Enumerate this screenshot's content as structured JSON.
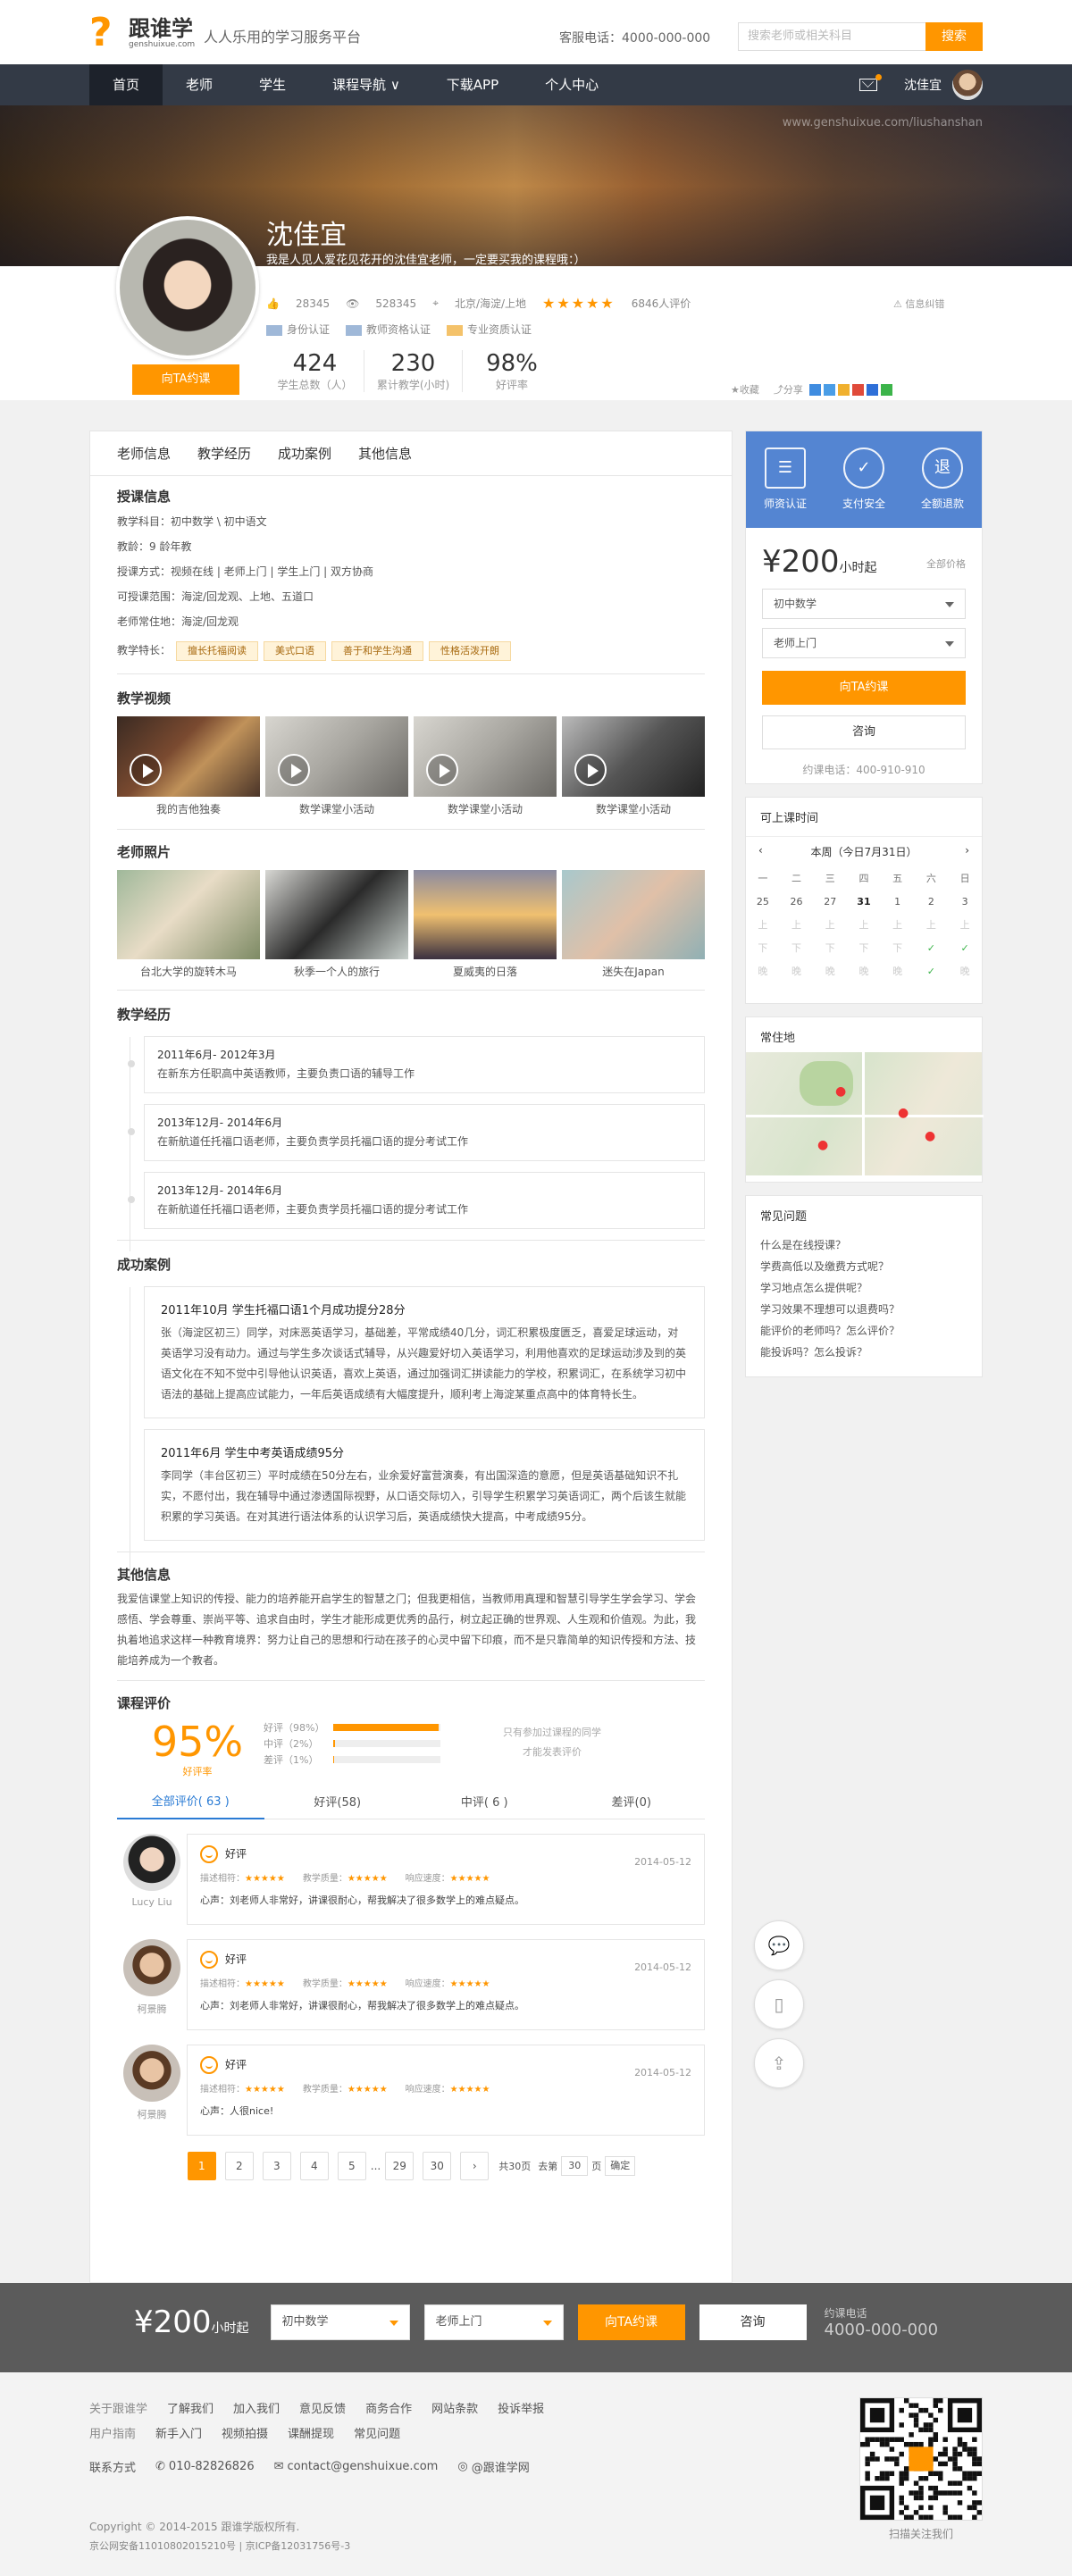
{
  "header": {
    "brand_cn": "跟谁学",
    "brand_en": "genshuixue.com",
    "slogan": "人人乐用的学习服务平台",
    "hotline": "客服电话：4000-000-000",
    "search_placeholder": "搜索老师或相关科目",
    "search_btn": "搜索"
  },
  "nav": {
    "items": [
      "首页",
      "老师",
      "学生",
      "课程导航 ∨",
      "下载APP",
      "个人中心"
    ],
    "user": "沈佳宜"
  },
  "banner": {
    "site": "www.genshuixue.com/liushanshan"
  },
  "teacher": {
    "name": "沈佳宜",
    "motto": "我是人见人爱花见花开的沈佳宜老师，一定要买我的课程哦：）",
    "likes": "28345",
    "views": "528345",
    "location": "北京/海淀/上地",
    "stars": "★★★★★",
    "reviews": "6846人评价",
    "certs": [
      "身份认证",
      "教师资格认证",
      "专业资质认证"
    ],
    "hire": "向TA约课",
    "report": "信息纠错",
    "fav": "收藏",
    "share": "分享",
    "nums": [
      {
        "v": "424",
        "l": "学生总数（人）"
      },
      {
        "v": "230",
        "l": "累计教学(小时)"
      },
      {
        "v": "98%",
        "l": "好评率"
      }
    ]
  },
  "tabs": [
    "老师信息",
    "教学经历",
    "成功案例",
    "其他信息"
  ],
  "info": {
    "title": "授课信息",
    "lines": [
      "教学科目：初中数学 \\ 初中语文",
      "教龄：9 龄年教",
      "授课方式：视频在线 | 老师上门 | 学生上门 | 双方协商",
      "可授课范围：海淀/回龙观、上地、五道口",
      "老师常住地：海淀/回龙观"
    ],
    "tag_label": "教学特长：",
    "tags": [
      "擅长托福阅读",
      "美式口语",
      "善于和学生沟通",
      "性格活泼开朗"
    ]
  },
  "videos": {
    "title": "教学视频",
    "items": [
      "我的吉他独奏",
      "数学课堂小活动",
      "数学课堂小活动",
      "数学课堂小活动"
    ]
  },
  "photos": {
    "title": "老师照片",
    "items": [
      "台北大学的旋转木马",
      "秋季一个人的旅行",
      "夏威夷的日落",
      "迷失在Japan"
    ]
  },
  "experience": {
    "title": "教学经历",
    "items": [
      {
        "d": "2011年6月- 2012年3月",
        "t": "在新东方任职高中英语教师，主要负责口语的辅导工作"
      },
      {
        "d": "2013年12月- 2014年6月",
        "t": "在新航道任托福口语老师，主要负责学员托福口语的提分考试工作"
      },
      {
        "d": "2013年12月- 2014年6月",
        "t": "在新航道任托福口语老师，主要负责学员托福口语的提分考试工作"
      }
    ]
  },
  "cases": {
    "title": "成功案例",
    "items": [
      {
        "d": "2011年10月  学生托福口语1个月成功提分28分",
        "t": "张（海淀区初三）同学，对床恶英语学习，基础差，平常成绩40几分，词汇积累极度匮乏，喜爱足球运动，对英语学习没有动力。通过与学生多次谈话式辅导，从兴趣爱好切入英语学习，利用他喜欢的足球运动涉及到的英语文化在不知不觉中引导他认识英语，喜欢上英语，通过加强词汇拼读能力的学校，积累词汇，在系统学习初中语法的基础上提高应试能力，一年后英语成绩有大幅度提升，顺利考上海淀某重点高中的体育特长生。"
      },
      {
        "d": "2011年6月  学生中考英语成绩95分",
        "t": "李同学（丰台区初三）平时成绩在50分左右，业余爱好富营演奏，有出国深造的意愿，但是英语基础知识不扎实，不愿付出，我在辅导中通过渗透国际视野，从口语交际切入，引导学生积累学习英语词汇，两个后该生就能积累的学习英语。在对其进行语法体系的认识学习后，英语成绩快大提高，中考成绩95分。"
      }
    ]
  },
  "other": {
    "title": "其他信息",
    "text": "我爱信课堂上知识的传授、能力的培养能开启学生的智慧之门；但我更相信，当教师用真理和智慧引导学生学会学习、学会感悟、学会尊重、崇尚平等、追求自由时，学生才能形成更优秀的品行，树立起正确的世界观、人生观和价值观。为此，我执着地追求这样一种教育境界：努力让自己的思想和行动在孩子的心灵中留下印痕，而不是只靠简单的知识传授和方法、技能培养成为一个教者。"
  },
  "eval": {
    "title": "课程评价",
    "pct": "95%",
    "pct_label": "好评率",
    "rows": [
      {
        "l": "好评（98%）",
        "v": 0.98
      },
      {
        "l": "中评（2%）",
        "v": 0.02
      },
      {
        "l": "差评（1%）",
        "v": 0.01
      }
    ],
    "note1": "只有参加过课程的同学",
    "note2": "才能发表评价",
    "tabs": [
      "全部评价( 63 )",
      "好评(58)",
      "中评( 6 )",
      "差评(0)"
    ],
    "metric1": "描述相符：",
    "metric2": "教学质量：",
    "metric3": "响应速度：",
    "mstars": "★★★★★",
    "reviews": [
      {
        "who": "Lucy Liu",
        "g": "好评",
        "date": "2014-05-12",
        "c": "心声：刘老师人非常好，讲课很耐心，帮我解决了很多数学上的难点疑点。"
      },
      {
        "who": "柯景腾",
        "g": "好评",
        "date": "2014-05-12",
        "c": "心声：刘老师人非常好，讲课很耐心，帮我解决了很多数学上的难点疑点。"
      },
      {
        "who": "柯景腾",
        "g": "好评",
        "date": "2014-05-12",
        "c": "心声：人很nice!"
      }
    ]
  },
  "pager": {
    "pages": [
      "1",
      "2",
      "3",
      "4",
      "5",
      "...",
      "29",
      "30"
    ],
    "total": "共30页",
    "goto": "去第",
    "goto_val": "30",
    "page": "页",
    "ok": "确定"
  },
  "sidebar": {
    "feat": [
      "师资认证",
      "支付安全",
      "全额退款"
    ],
    "price": "¥200",
    "unit": "小时起",
    "all_price": "全部价格",
    "sel1": "初中数学",
    "sel2": "老师上门",
    "hire": "向TA约课",
    "consult": "咨询",
    "phone": "约课电话：400-910-910",
    "cal_title": "可上课时间",
    "cal_week": "本周（今日7月31日）",
    "weekdays": [
      "一",
      "二",
      "三",
      "四",
      "五",
      "六",
      "日"
    ],
    "dates": [
      "25",
      "26",
      "27",
      "31",
      "1",
      "2",
      "3"
    ],
    "rows": [
      [
        "上",
        "上",
        "上",
        "上",
        "上",
        "上",
        "上"
      ],
      [
        "下",
        "下",
        "下",
        "下",
        "下",
        "✓",
        "✓"
      ],
      [
        "晚",
        "晚",
        "晚",
        "晚",
        "晚",
        "✓",
        "晚"
      ]
    ],
    "map_title": "常住地",
    "faq_title": "常见问题",
    "faq": [
      "什么是在线授课？",
      "学费高低以及缴费方式呢？",
      "学习地点怎么提供呢？",
      "学习效果不理想可以退费吗？",
      "能评价的老师吗？怎么评价？",
      "能投诉吗？怎么投诉？"
    ]
  },
  "bottombar": {
    "price": "¥200",
    "unit": "小时起",
    "sel1": "初中数学",
    "sel2": "老师上门",
    "hire": "向TA约课",
    "consult": "咨询",
    "phone_label": "约课电话",
    "phone": "4000-000-000"
  },
  "footer": {
    "row1": [
      "关于跟谁学",
      "了解我们",
      "加入我们",
      "意见反馈",
      "商务合作",
      "网站条款",
      "投诉举报"
    ],
    "row2": [
      "用户指南",
      "新手入门",
      "视频拍摄",
      "课酬提现",
      "常见问题"
    ],
    "contact": "联系方式",
    "tel": "010-82826826",
    "mail": "contact@genshuixue.com",
    "weibo": "@跟谁学网",
    "copyright": "Copyright © 2014-2015 跟谁学版权所有.",
    "icp": "京公网安备11010802015210号 | 京ICP备12031756号-3",
    "qr_label": "扫描关注我们"
  }
}
